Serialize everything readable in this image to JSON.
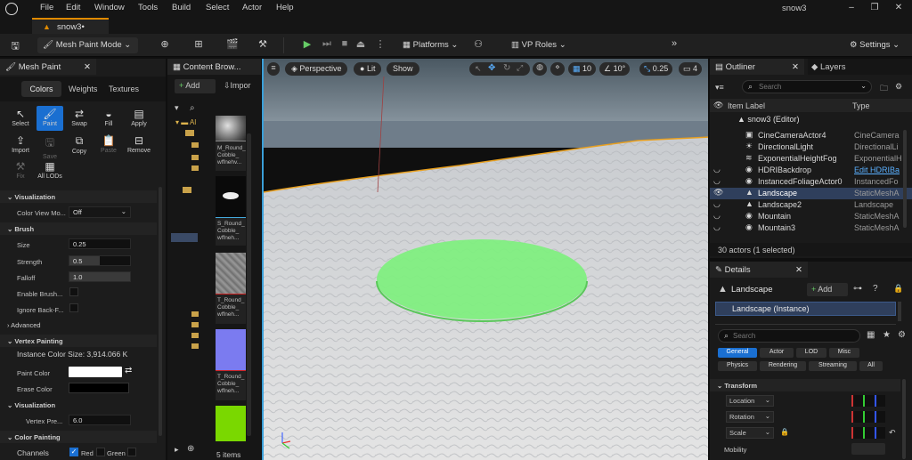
{
  "menu": {
    "items": [
      "File",
      "Edit",
      "Window",
      "Tools",
      "Build",
      "Select",
      "Actor",
      "Help"
    ],
    "project": "snow3"
  },
  "doc_tab": {
    "label": "snow3•"
  },
  "toolbar": {
    "mode": "Mesh Paint Mode",
    "platforms": "Platforms",
    "vp_roles": "VP Roles",
    "settings": "Settings"
  },
  "mesh_paint": {
    "title": "Mesh Paint",
    "tabs": [
      "Colors",
      "Weights",
      "Textures"
    ],
    "tools_row1": [
      "Select",
      "Paint",
      "Swap",
      "Fill",
      "Apply"
    ],
    "tools_row2": [
      "Import",
      "Save",
      "Copy",
      "Paste",
      "Remove"
    ],
    "tools_row3": [
      "Fix",
      "All LODs"
    ],
    "sections": {
      "visualization": "Visualization",
      "brush": "Brush",
      "advanced": "Advanced",
      "vertex_painting": "Vertex Painting",
      "visualization2": "Visualization",
      "color_painting": "Color Painting"
    },
    "color_view_mode": {
      "label": "Color View Mo...",
      "value": "Off"
    },
    "size": {
      "label": "Size",
      "value": "0.25"
    },
    "strength": {
      "label": "Strength",
      "value": "0.5"
    },
    "falloff": {
      "label": "Falloff",
      "value": "1.0"
    },
    "enable_brush": {
      "label": "Enable Brush..."
    },
    "ignore_back": {
      "label": "Ignore Back-F..."
    },
    "instance_color_size": "Instance Color Size: 3,914.066 K",
    "paint_color": {
      "label": "Paint Color",
      "color": "#ffffff"
    },
    "erase_color": {
      "label": "Erase Color",
      "color": "#000000"
    },
    "vertex_preview": {
      "label": "Vertex Pre...",
      "value": "6.0"
    },
    "channels": {
      "label": "Channels",
      "red": "Red",
      "green": "Green"
    }
  },
  "content_browser": {
    "title": "Content Brow...",
    "add": "Add",
    "import": "Impor",
    "tree_root": "Al",
    "assets": [
      {
        "name": "M_Round_ Cobble_ wffnehv...",
        "accent": "#888888"
      },
      {
        "name": "S_Round_ Cobble_ wffneh...",
        "accent": "#ffffff"
      },
      {
        "name": "T_Round_ Cobble_ wffneh...",
        "accent": "#cc2222"
      },
      {
        "name": "T_Round_ Cobble_ wffneh...",
        "accent": "#cc2222"
      },
      {
        "name": "",
        "accent": "#7ad800"
      }
    ],
    "count": "5 items"
  },
  "viewport": {
    "perspective": "Perspective",
    "lit": "Lit",
    "show": "Show",
    "grid": "10",
    "angle": "10°",
    "scale": "0.25",
    "cam": "4"
  },
  "outliner": {
    "title": "Outliner",
    "layers": "Layers",
    "search_placeholder": "Search",
    "col_label": "Item Label",
    "col_type": "Type",
    "world": "snow3 (Editor)",
    "rows": [
      {
        "name": "CineCameraActor4",
        "type": "CineCamera"
      },
      {
        "name": "DirectionalLight",
        "type": "DirectionalLi"
      },
      {
        "name": "ExponentialHeightFog",
        "type": "ExponentialH"
      },
      {
        "name": "HDRIBackdrop",
        "type": "Edit HDRIBa"
      },
      {
        "name": "InstancedFoliageActor0",
        "type": "InstancedFo"
      },
      {
        "name": "Landscape",
        "type": "StaticMeshA"
      },
      {
        "name": "Landscape2",
        "type": "Landscape"
      },
      {
        "name": "Mountain",
        "type": "StaticMeshA"
      },
      {
        "name": "Mountain3",
        "type": "StaticMeshA"
      }
    ],
    "status": "30 actors (1 selected)"
  },
  "details": {
    "title": "Details",
    "actor": "Landscape",
    "add": "Add",
    "instance": "Landscape (Instance)",
    "search_placeholder": "Search",
    "filters": [
      "General",
      "Actor",
      "LOD",
      "Misc",
      "Physics",
      "Rendering",
      "Streaming",
      "All"
    ],
    "transform": "Transform",
    "location": "Location",
    "rotation": "Rotation",
    "scale": "Scale",
    "mobility": "Mobility"
  }
}
